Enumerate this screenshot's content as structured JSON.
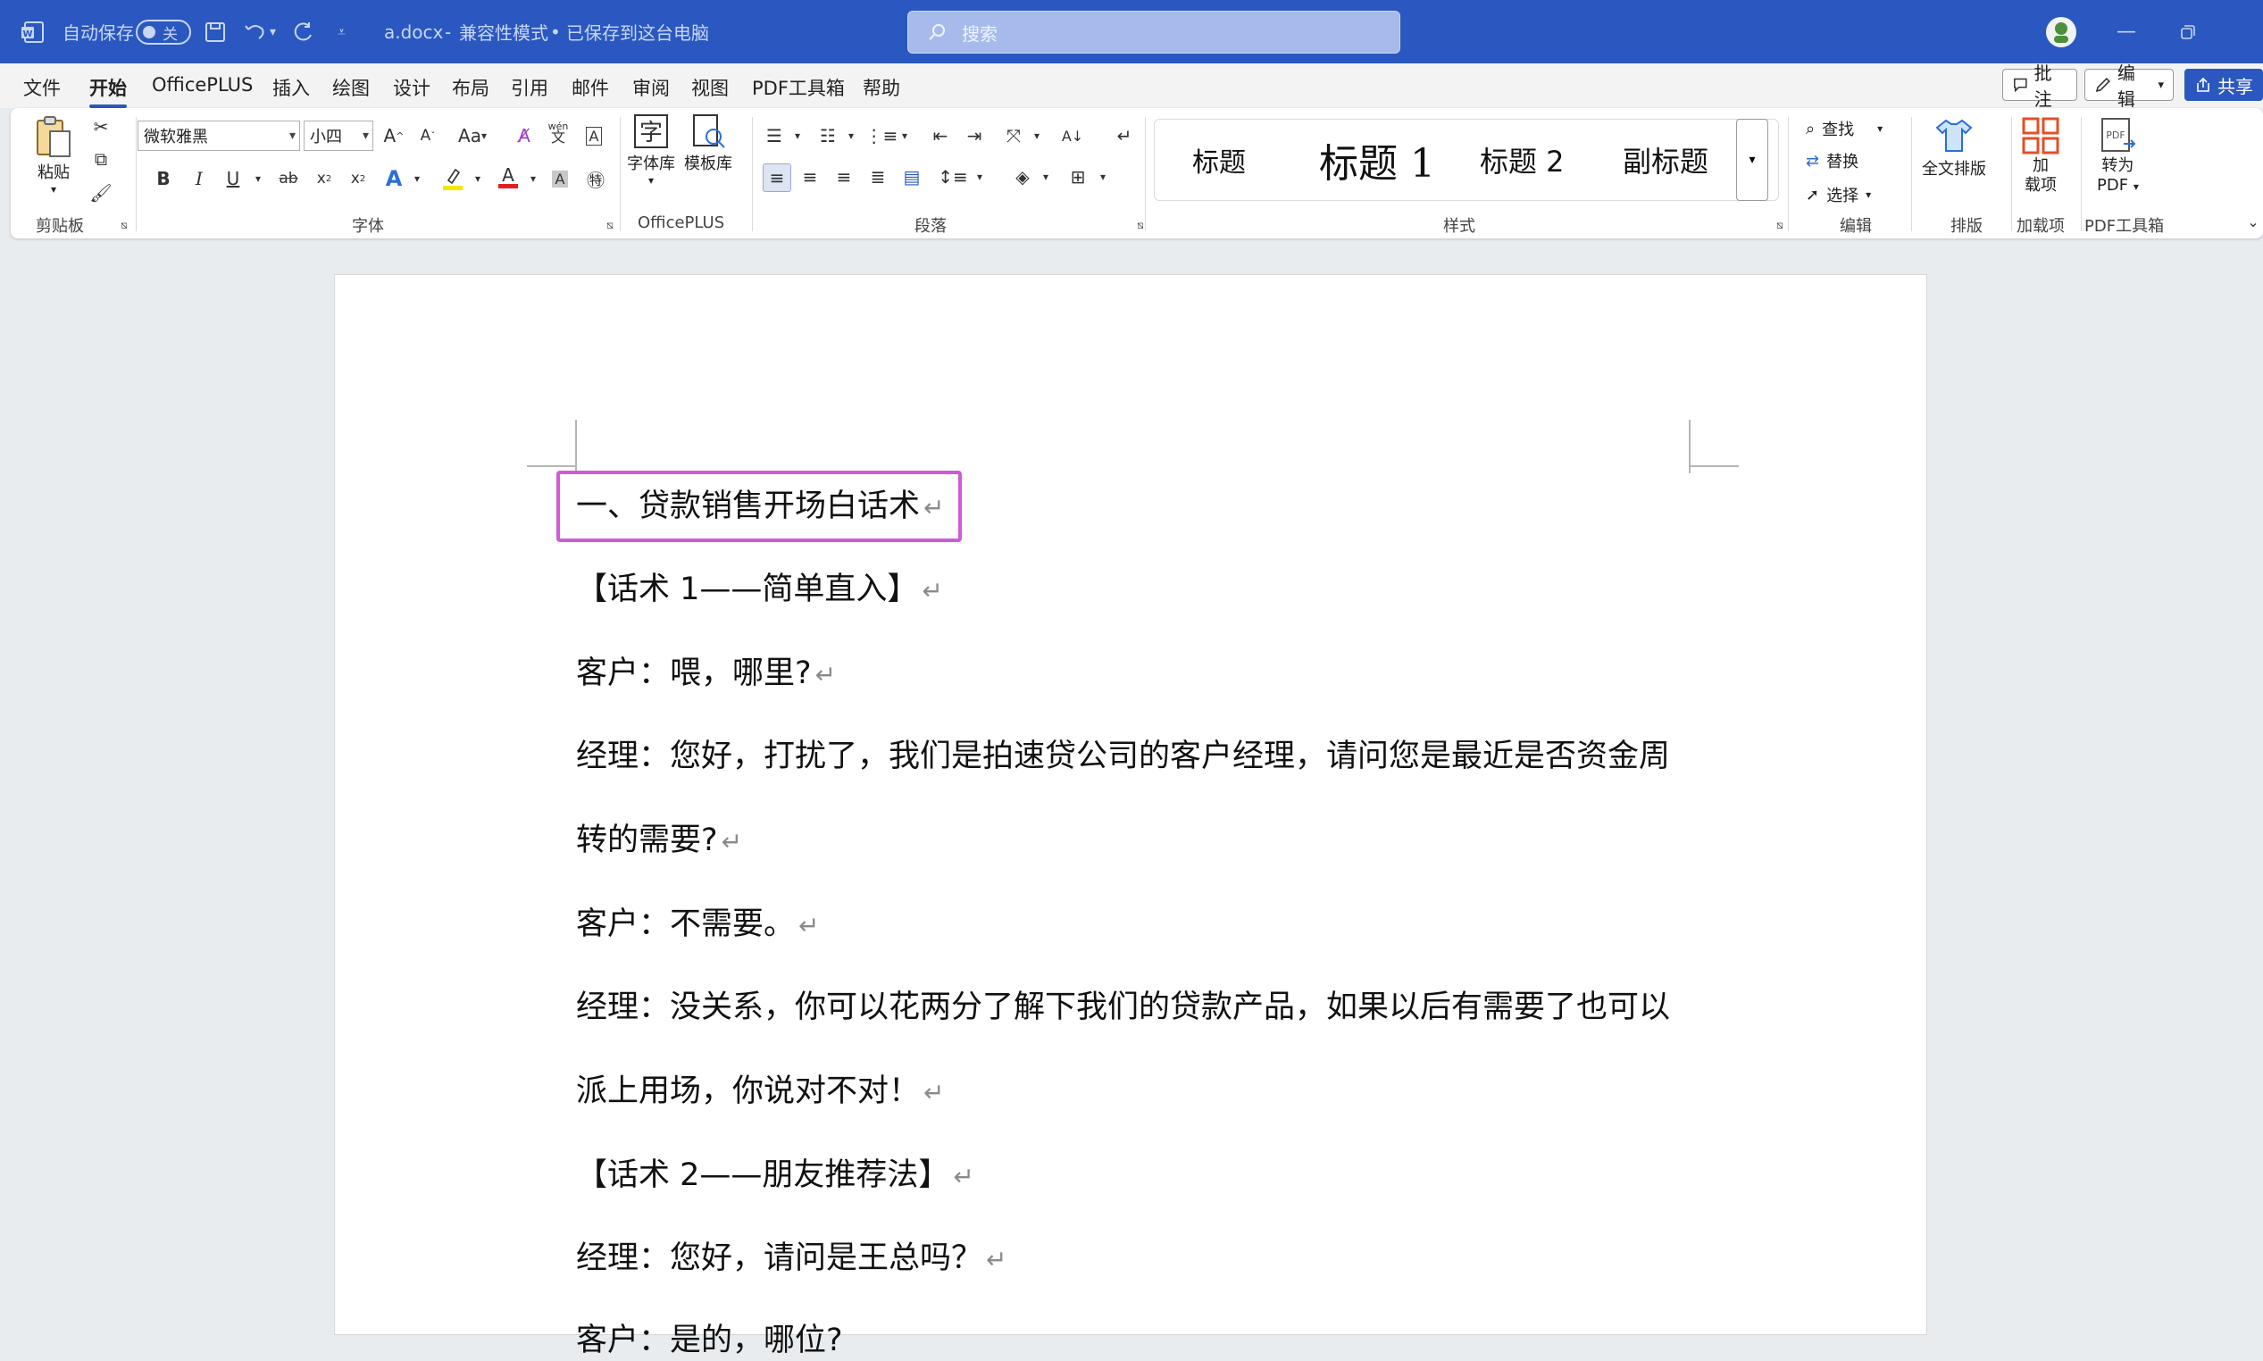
{
  "titlebar": {
    "autosave_label": "自动保存",
    "autosave_state": "关",
    "filename": "a.docx",
    "mode": "兼容性模式",
    "save_status": "已保存到这台电脑",
    "separator": "•",
    "search_placeholder": "搜索"
  },
  "menu": {
    "items": [
      "文件",
      "开始",
      "OfficePLUS",
      "插入",
      "绘图",
      "设计",
      "布局",
      "引用",
      "邮件",
      "审阅",
      "视图",
      "PDF工具箱",
      "帮助"
    ],
    "active": "开始",
    "comment_btn": "批注",
    "edit_btn": "编辑",
    "share_btn": "共享"
  },
  "ribbon": {
    "clipboard": {
      "paste": "粘贴",
      "label": "剪贴板"
    },
    "font": {
      "name": "微软雅黑",
      "size": "小四",
      "label": "字体",
      "grow": "A^",
      "shrink": "A^",
      "case": "Aa",
      "pinyin": "wén",
      "pinyin_char": "文"
    },
    "officeplus": {
      "font_lib": "字体库",
      "template_lib": "模板库",
      "label": "OfficePLUS"
    },
    "paragraph": {
      "label": "段落"
    },
    "styles": {
      "items": [
        "标题",
        "标题 1",
        "标题 2",
        "副标题"
      ],
      "label": "样式"
    },
    "editing": {
      "find": "查找",
      "replace": "替换",
      "select": "选择",
      "label": "编辑"
    },
    "layout": {
      "full_layout": "全文排版",
      "label": "排版"
    },
    "addins": {
      "addin_line1": "加",
      "addin_line2": "载项",
      "label": "加载项"
    },
    "pdf": {
      "convert_line1": "转为",
      "convert_line2": "PDF",
      "pdf_icon_text": "PDF",
      "label": "PDF工具箱"
    }
  },
  "document": {
    "paragraphs": [
      "一、贷款销售开场白话术",
      "【话术 1——简单直入】",
      "客户：喂，哪里?",
      "经理：您好，打扰了，我们是拍速贷公司的客户经理，请问您是最近是否资金周",
      "转的需要?",
      "客户：不需要。",
      "经理：没关系，你可以花两分了解下我们的贷款产品，如果以后有需要了也可以",
      "派上用场，你说对不对！",
      "【话术 2——朋友推荐法】",
      "经理：您好，请问是王总吗？",
      "客户：是的，哪位?"
    ],
    "return_mark": "↵"
  },
  "colors": {
    "accent": "#2a58c0",
    "highlight_box": "#d05ad8"
  }
}
